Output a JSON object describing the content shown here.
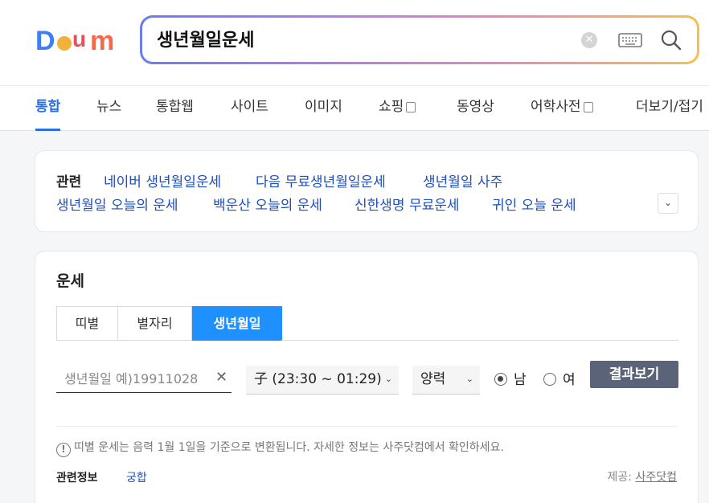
{
  "search": {
    "query": "생년월일운세",
    "logo_text": "Daum"
  },
  "tabs": [
    {
      "label": "통합",
      "active": true
    },
    {
      "label": "뉴스"
    },
    {
      "label": "통합웹"
    },
    {
      "label": "사이트"
    },
    {
      "label": "이미지"
    },
    {
      "label": "쇼핑"
    },
    {
      "label": "동영상"
    },
    {
      "label": "어학사전"
    },
    {
      "label": "더보기/접기"
    }
  ],
  "related": {
    "label": "관련",
    "links": [
      "네이버 생년월일운세",
      "다음 무료생년월일운세",
      "생년월일 사주",
      "생년월일 오늘의 운세",
      "백운산 오늘의 운세",
      "신한생명 무료운세",
      "귀인 오늘 운세"
    ]
  },
  "fortune": {
    "title": "운세",
    "tabs": [
      "띠별",
      "별자리",
      "생년월일"
    ],
    "active_tab": "생년월일",
    "birth_placeholder": "생년월일 예)19911028",
    "time_select": "子 (23:30 ~ 01:29)",
    "calendar_select": "양력",
    "gender": {
      "male": "남",
      "female": "여",
      "selected": "남"
    },
    "result_button": "결과보기",
    "notice": "띠별 운세는 음력 1월 1일을 기준으로 변환됩니다. 자세한 정보는 사주닷컴에서 확인하세요.",
    "info_label": "관련정보",
    "info_link": "궁합",
    "provider_label": "제공:",
    "provider_link": "사주닷컴"
  },
  "colors": {
    "accent": "#2a6ee8",
    "link": "#1e4fc0",
    "active_tab_bg": "#1e90ff",
    "result_btn": "#5a6378"
  }
}
